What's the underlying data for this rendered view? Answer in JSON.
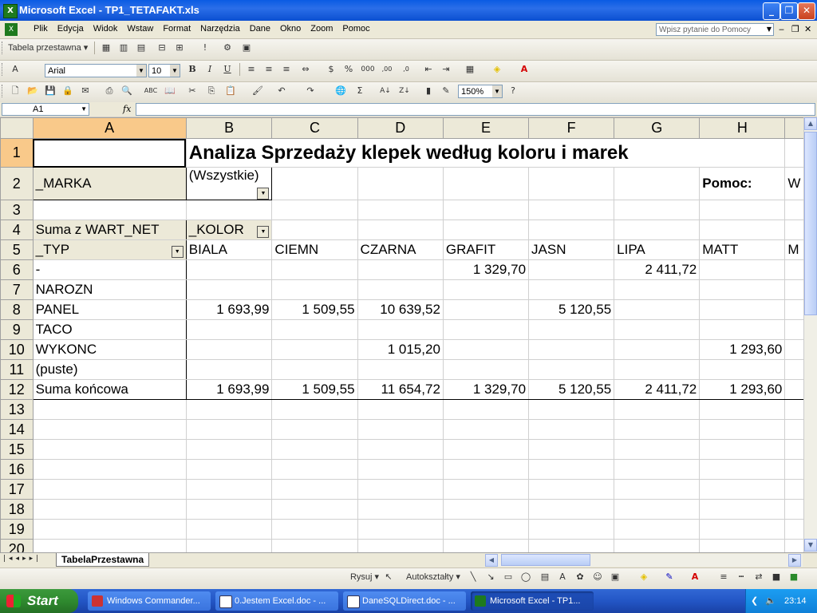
{
  "window": {
    "title": "Microsoft Excel - TP1_TETAFAKT.xls"
  },
  "menu": {
    "items": [
      "Plik",
      "Edycja",
      "Widok",
      "Wstaw",
      "Format",
      "Narzędzia",
      "Dane",
      "Okno",
      "Zoom",
      "Pomoc"
    ],
    "help_placeholder": "Wpisz pytanie do Pomocy"
  },
  "pivot_toolbar": {
    "label": "Tabela przestawna ▾"
  },
  "format_toolbar": {
    "font": "Arial",
    "size": "10"
  },
  "standard_toolbar": {
    "zoom": "150%"
  },
  "formula_bar": {
    "name_box": "A1",
    "fx": "fx",
    "formula": ""
  },
  "sheet": {
    "columns": [
      "A",
      "B",
      "C",
      "D",
      "E",
      "F",
      "G",
      "H"
    ],
    "title": "Analiza Sprzedaży klepek według koloru i marek",
    "marka_label": "_MARKA",
    "marka_value": "(Wszystkie)",
    "pomoc_label": "Pomoc:",
    "pomoc_value": "W",
    "data_label": "Suma z WART_NET",
    "col_field": "_KOLOR",
    "row_field": "_TYP",
    "color_headers": [
      "BIALA",
      "CIEMN",
      "CZARNA",
      "GRAFIT",
      "JASN",
      "LIPA",
      "MATT"
    ],
    "color_header_extra": "M",
    "rows": [
      {
        "n": "6",
        "label": "-",
        "values": [
          "",
          "",
          "",
          "1 329,70",
          "",
          "2 411,72",
          ""
        ]
      },
      {
        "n": "7",
        "label": "NAROZN",
        "values": [
          "",
          "",
          "",
          "",
          "",
          "",
          ""
        ]
      },
      {
        "n": "8",
        "label": "PANEL",
        "values": [
          "1 693,99",
          "1 509,55",
          "10 639,52",
          "",
          "5 120,55",
          "",
          ""
        ]
      },
      {
        "n": "9",
        "label": "TACO",
        "values": [
          "",
          "",
          "",
          "",
          "",
          "",
          ""
        ]
      },
      {
        "n": "10",
        "label": "WYKONC",
        "values": [
          "",
          "",
          "1 015,20",
          "",
          "",
          "",
          "1 293,60"
        ]
      },
      {
        "n": "11",
        "label": "(puste)",
        "values": [
          "",
          "",
          "",
          "",
          "",
          "",
          ""
        ]
      },
      {
        "n": "12",
        "label": "Suma końcowa",
        "values": [
          "1 693,99",
          "1 509,55",
          "11 654,72",
          "1 329,70",
          "5 120,55",
          "2 411,72",
          "1 293,60"
        ]
      }
    ],
    "empty_rows": [
      "13",
      "14",
      "15",
      "16",
      "17",
      "18",
      "19",
      "20"
    ],
    "top_rows": [
      "1",
      "2",
      "3",
      "4",
      "5"
    ]
  },
  "tabs": {
    "active": "TabelaPrzestawna"
  },
  "drawing_toolbar": {
    "draw_label": "Rysuj ▾",
    "autoshapes_label": "Autokształty ▾"
  },
  "taskbar": {
    "start": "Start",
    "tasks": [
      "Windows Commander...",
      "0.Jestem Excel.doc - ...",
      "DaneSQLDirect.doc - ...",
      "Microsoft Excel - TP1..."
    ],
    "clock": "23:14"
  },
  "colors": {
    "selected_header": "#f9c98a",
    "titlebar": "#0a5be3",
    "taskbar": "#2356c5",
    "start": "#2f8a2f"
  }
}
